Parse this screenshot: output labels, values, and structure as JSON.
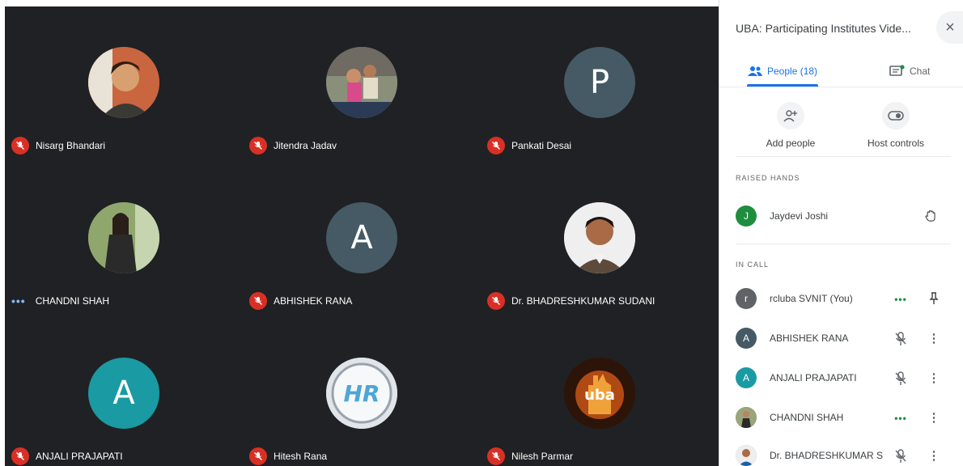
{
  "tiles": [
    {
      "name": "Nisarg Bhandari",
      "avatar": "photo-icon",
      "muted": true
    },
    {
      "name": "Jitendra Jadav",
      "avatar": "photo-icon",
      "muted": true
    },
    {
      "name": "Pankati Desai",
      "avatar_letter": "P",
      "muted": true
    },
    {
      "name": "CHANDNI SHAH",
      "avatar": "photo-icon",
      "muted": false
    },
    {
      "name": "ABHISHEK RANA",
      "avatar_letter": "A",
      "muted": true
    },
    {
      "name": "Dr. BHADRESHKUMAR SUDANI",
      "avatar": "photo-icon",
      "muted": true
    },
    {
      "name": "ANJALI PRAJAPATI",
      "avatar_letter": "A",
      "muted": true
    },
    {
      "name": "Hitesh Rana",
      "avatar_text": "HR",
      "muted": true
    },
    {
      "name": "Nilesh Parmar",
      "avatar_text": "uba",
      "muted": true
    }
  ],
  "panel": {
    "title": "UBA: Participating Institutes Vide...",
    "close_icon": "×",
    "tabs": [
      {
        "label": "People (18)",
        "icon": "people-icon",
        "active": true
      },
      {
        "label": "Chat",
        "icon": "chat-icon",
        "active": false
      }
    ],
    "actions": [
      {
        "label": "Add people",
        "icon": "add-person-icon"
      },
      {
        "label": "Host controls",
        "icon": "toggle-icon"
      }
    ],
    "raised_hands_heading": "RAISED HANDS",
    "raised_hands": [
      {
        "name": "Jaydevi Joshi",
        "letter": "J",
        "color": "#1e8e3e"
      }
    ],
    "in_call_heading": "IN CALL",
    "in_call": [
      {
        "name": "rcluba SVNIT (You)",
        "letter": "r",
        "color": "#5f6368"
      },
      {
        "name": "ABHISHEK RANA",
        "letter": "A",
        "color": "#455a64"
      },
      {
        "name": "ANJALI PRAJAPATI",
        "letter": "A",
        "color": "#1a9aa3"
      },
      {
        "name": "CHANDNI SHAH",
        "letter": "",
        "color": "#8d8d6e"
      },
      {
        "name": "Dr. BHADRESHKUMAR S...",
        "letter": "",
        "color": "#7a8a99"
      }
    ]
  },
  "colors": {
    "grid_bg": "#202124",
    "accent": "#1a73e8",
    "muted_red": "#d93025"
  }
}
